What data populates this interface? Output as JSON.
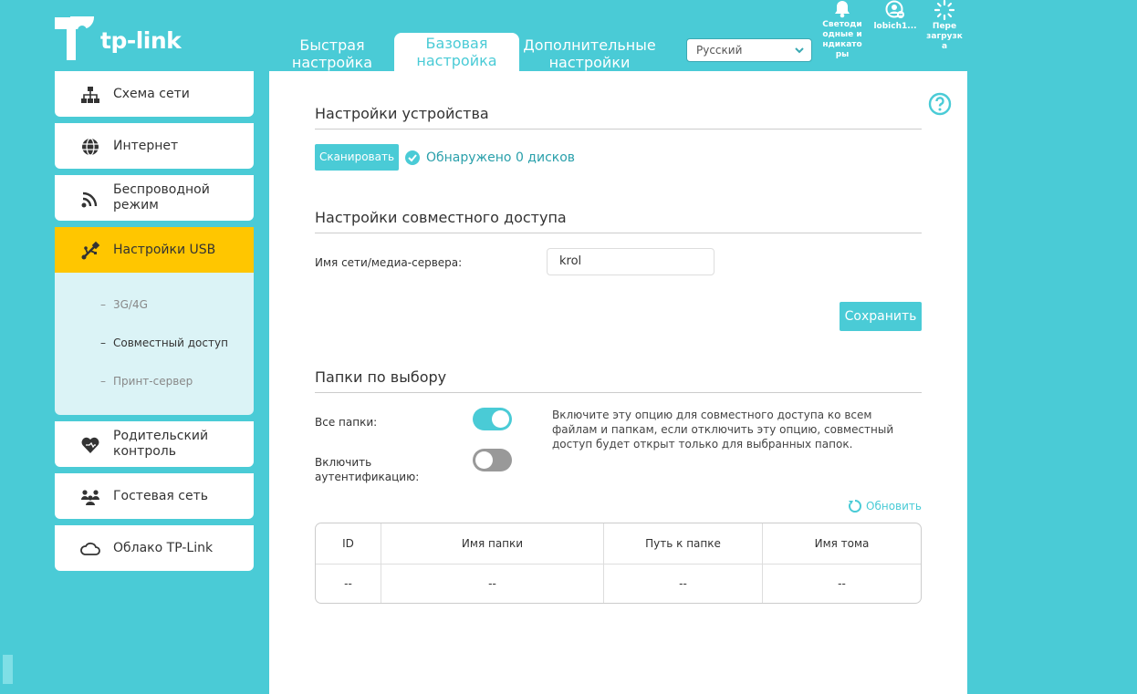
{
  "brand": {
    "name": "tp-link",
    "accent": "#4acbd6",
    "highlight": "#ffc600"
  },
  "top_tabs": [
    {
      "label1": "Быстрая",
      "label2": "настройка"
    },
    {
      "label1": "Базовая",
      "label2": "настройка"
    },
    {
      "label1": "Дополнительные",
      "label2": "настройки"
    }
  ],
  "language": {
    "selected": "Русский"
  },
  "top_icons": [
    {
      "name": "bell-icon",
      "label": "Светоди одные и ндикато ры"
    },
    {
      "name": "user-icon",
      "label": "lobich1..."
    },
    {
      "name": "reboot-icon",
      "label": "Пере загрузк а"
    }
  ],
  "sidebar": {
    "items": [
      {
        "label": "Схема сети",
        "icon": "network-map-icon"
      },
      {
        "label": "Интернет",
        "icon": "globe-icon"
      },
      {
        "label": "Беспроводной режим",
        "icon": "wireless-icon"
      },
      {
        "label": "Настройки USB",
        "icon": "usb-icon"
      },
      {
        "label": "Родительский контроль",
        "icon": "parental-heart-icon"
      },
      {
        "label": "Гостевая сеть",
        "icon": "guest-network-icon"
      },
      {
        "label": "Облако TP-Link",
        "icon": "cloud-icon"
      }
    ],
    "usb_sub": [
      "3G/4G",
      "Совместный доступ",
      "Принт-сервер"
    ],
    "dash": "–"
  },
  "device": {
    "title": "Настройки устройства",
    "scan_label": "Сканировать",
    "status": "Обнаружено 0 дисков"
  },
  "sharing": {
    "title": "Настройки совместного доступа",
    "name_label": "Имя сети/медиа-сервера:",
    "name_value": "krol",
    "save_label": "Сохранить"
  },
  "folders": {
    "title": "Папки по выбору",
    "all_label": "Все папки:",
    "all_on": true,
    "auth_label": "Включить аутентификацию:",
    "auth_on": false,
    "description": "Включите эту опцию для совместного доступа ко всем файлам и папкам, если отключить эту опцию, совместный доступ будет открыт только для выбранных папок.",
    "refresh_label": "Обновить"
  },
  "table": {
    "headers": [
      "ID",
      "Имя папки",
      "Путь к папке",
      "Имя тома"
    ],
    "rows": [
      [
        "--",
        "--",
        "--",
        "--"
      ]
    ]
  }
}
